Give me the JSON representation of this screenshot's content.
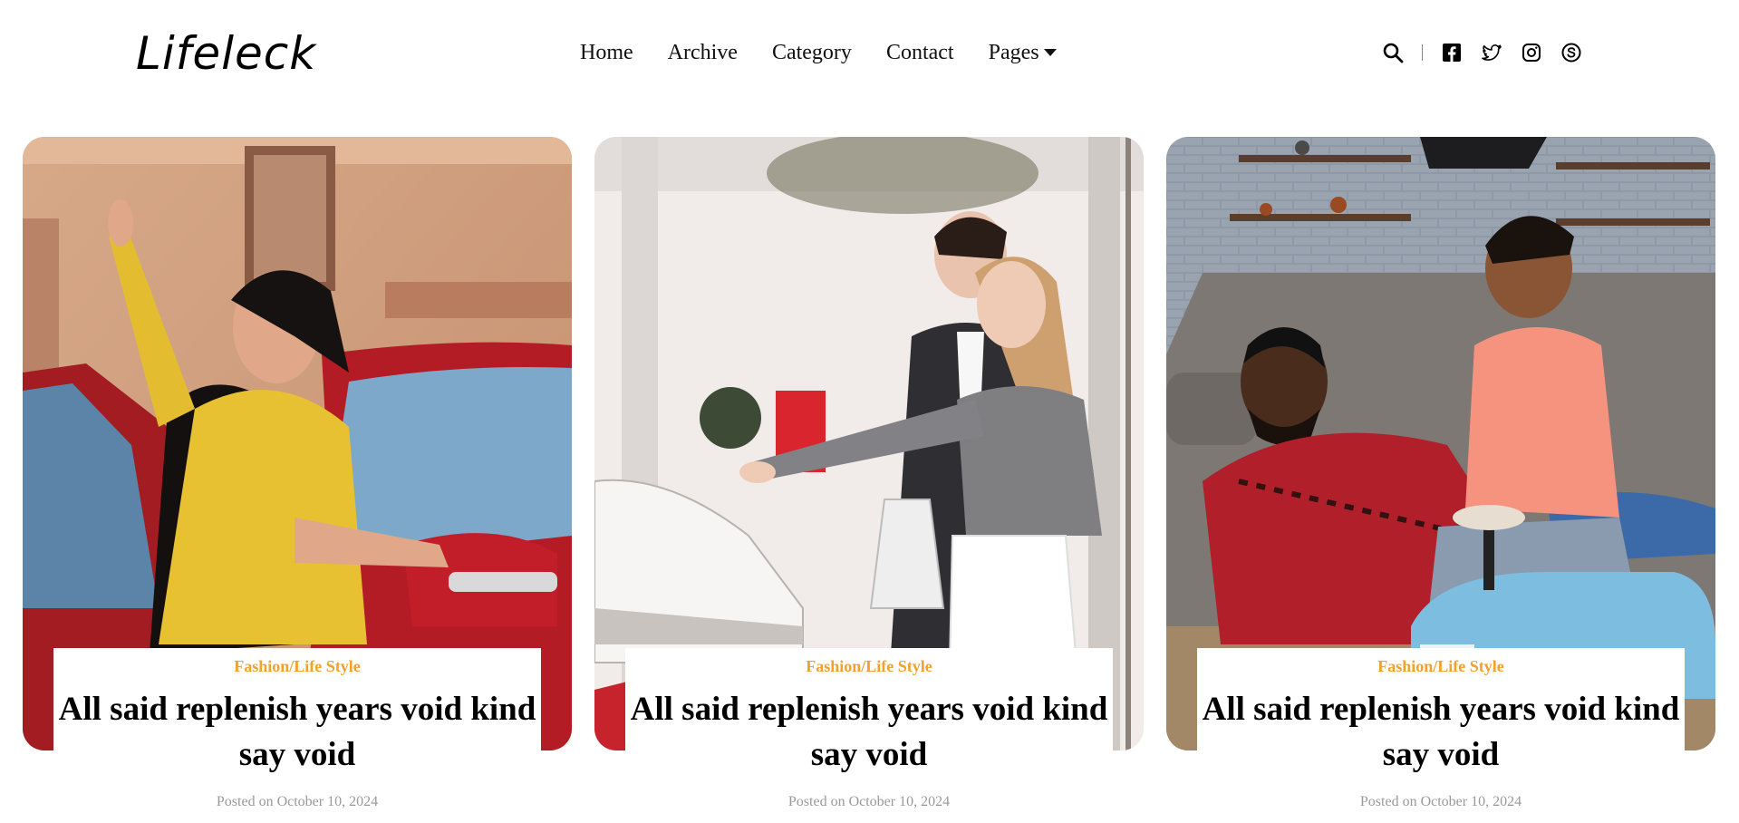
{
  "brand": {
    "logo_text": "Lifeleck"
  },
  "nav": {
    "items": [
      "Home",
      "Archive",
      "Category",
      "Contact"
    ],
    "pages_label": "Pages"
  },
  "toolbar": {
    "icons": [
      "search-icon",
      "facebook-icon",
      "twitter-icon",
      "instagram-icon",
      "skype-icon"
    ]
  },
  "cards": [
    {
      "category": "Fashion/Life Style",
      "title": "All said replenish years void kind say void",
      "date": "Posted on October 10, 2024",
      "image": "woman-yellow-sweater-red-car"
    },
    {
      "category": "Fashion/Life Style",
      "title": "All said replenish years void kind say void",
      "date": "Posted on October 10, 2024",
      "image": "couple-car-showroom"
    },
    {
      "category": "Fashion/Life Style",
      "title": "All said replenish years void kind say void",
      "date": "Posted on October 10, 2024",
      "image": "father-son-toy-car"
    }
  ],
  "colors": {
    "accent": "#f2a12a",
    "text": "#000000",
    "muted": "#9a9a9a"
  }
}
